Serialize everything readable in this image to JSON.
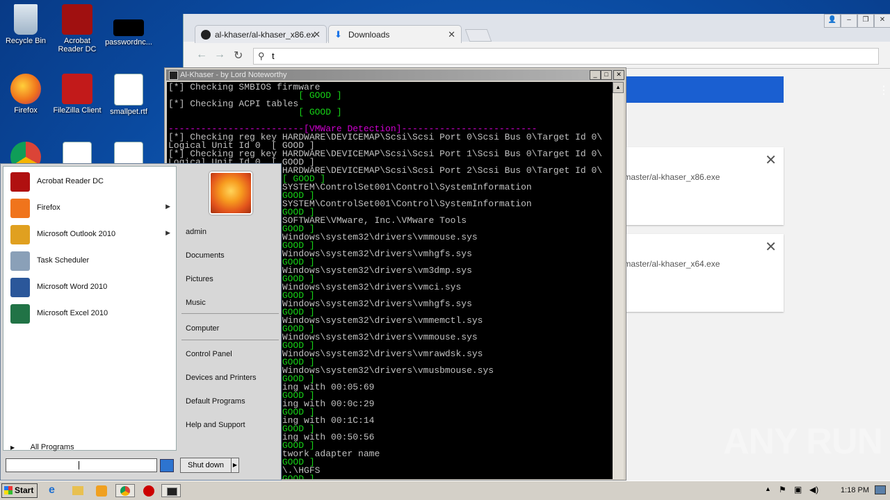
{
  "desktop": {
    "icons": [
      {
        "label": "Recycle Bin"
      },
      {
        "label": "Acrobat Reader DC"
      },
      {
        "label": "passwordnc..."
      },
      {
        "label": "Firefox"
      },
      {
        "label": "FileZilla Client"
      },
      {
        "label": "smallpet.rtf"
      }
    ]
  },
  "chrome": {
    "tabs": [
      {
        "label": "al-khaser/al-khaser_x86.ex"
      },
      {
        "label": "Downloads"
      }
    ],
    "address": "t",
    "downloads": [
      {
        "url": "/master/al-khaser_x86.exe"
      },
      {
        "url": "/master/al-khaser_x64.exe"
      }
    ]
  },
  "console": {
    "title": "Al-Khaser - by Lord Noteworthy",
    "lines": [
      {
        "text": "[*] Checking SMBIOS firmware",
        "style": "w"
      },
      {
        "text": "                        [ GOOD ]",
        "style": "g"
      },
      {
        "text": "[*] Checking ACPI tables",
        "style": "w"
      },
      {
        "text": "                        [ GOOD ]",
        "style": "g"
      },
      {
        "text": "",
        "style": "w"
      },
      {
        "text": "-------------------------[VMWare Detection]-------------------------",
        "style": "m"
      },
      {
        "text": "[*] Checking reg key HARDWARE\\DEVICEMAP\\Scsi\\Scsi Port 0\\Scsi Bus 0\\Target Id 0\\",
        "style": "w"
      },
      {
        "text": "Logical Unit Id 0  [ GOOD ]",
        "style": "w"
      },
      {
        "text": "[*] Checking reg key HARDWARE\\DEVICEMAP\\Scsi\\Scsi Port 1\\Scsi Bus 0\\Target Id 0\\",
        "style": "w"
      },
      {
        "text": "Logical Unit Id 0  [ GOOD ]",
        "style": "w"
      },
      {
        "text": "                     HARDWARE\\DEVICEMAP\\Scsi\\Scsi Port 2\\Scsi Bus 0\\Target Id 0\\",
        "style": "w"
      },
      {
        "text": "                     [ GOOD ]",
        "style": "g"
      },
      {
        "text": "                     SYSTEM\\ControlSet001\\Control\\SystemInformation",
        "style": "w"
      },
      {
        "text": "                     GOOD ]",
        "style": "g"
      },
      {
        "text": "                     SYSTEM\\ControlSet001\\Control\\SystemInformation",
        "style": "w"
      },
      {
        "text": "                     GOOD ]",
        "style": "g"
      },
      {
        "text": "                     SOFTWARE\\VMware, Inc.\\VMware Tools",
        "style": "w"
      },
      {
        "text": "                     GOOD ]",
        "style": "g"
      },
      {
        "text": "                    \\Windows\\system32\\drivers\\vmmouse.sys",
        "style": "w"
      },
      {
        "text": "                     GOOD ]",
        "style": "g"
      },
      {
        "text": "                    \\Windows\\system32\\drivers\\vmhgfs.sys",
        "style": "w"
      },
      {
        "text": "                     GOOD ]",
        "style": "g"
      },
      {
        "text": "                    \\Windows\\system32\\drivers\\vm3dmp.sys",
        "style": "w"
      },
      {
        "text": "                     GOOD ]",
        "style": "g"
      },
      {
        "text": "                    \\Windows\\system32\\drivers\\vmci.sys",
        "style": "w"
      },
      {
        "text": "                     GOOD ]",
        "style": "g"
      },
      {
        "text": "                    \\Windows\\system32\\drivers\\vmhgfs.sys",
        "style": "w"
      },
      {
        "text": "                     GOOD ]",
        "style": "g"
      },
      {
        "text": "                    \\Windows\\system32\\drivers\\vmmemctl.sys",
        "style": "w"
      },
      {
        "text": "                     GOOD ]",
        "style": "g"
      },
      {
        "text": "                    \\Windows\\system32\\drivers\\vmmouse.sys",
        "style": "w"
      },
      {
        "text": "                     GOOD ]",
        "style": "g"
      },
      {
        "text": "                    \\Windows\\system32\\drivers\\vmrawdsk.sys",
        "style": "w"
      },
      {
        "text": "                     GOOD ]",
        "style": "g"
      },
      {
        "text": "                    \\Windows\\system32\\drivers\\vmusbmouse.sys",
        "style": "w"
      },
      {
        "text": "                     GOOD ]",
        "style": "g"
      },
      {
        "text": "                    ting with 00:05:69",
        "style": "w"
      },
      {
        "text": "                     GOOD ]",
        "style": "g"
      },
      {
        "text": "                    ting with 00:0c:29",
        "style": "w"
      },
      {
        "text": "                     GOOD ]",
        "style": "g"
      },
      {
        "text": "                    ting with 00:1C:14",
        "style": "w"
      },
      {
        "text": "                     GOOD ]",
        "style": "g"
      },
      {
        "text": "                    ting with 00:50:56",
        "style": "w"
      },
      {
        "text": "                     GOOD ]",
        "style": "g"
      },
      {
        "text": "                    etwork adapter name",
        "style": "w"
      },
      {
        "text": "                     GOOD ]",
        "style": "g"
      },
      {
        "text": "                    \\\\.\\HGFS",
        "style": "w"
      },
      {
        "text": "                     GOOD ]",
        "style": "g"
      }
    ]
  },
  "startmenu": {
    "programs": [
      {
        "label": "Acrobat Reader DC",
        "has_arrow": false,
        "color": "#b01010"
      },
      {
        "label": "Firefox",
        "has_arrow": true,
        "color": "#f0741c"
      },
      {
        "label": "Microsoft Outlook 2010",
        "has_arrow": true,
        "color": "#e0a020"
      },
      {
        "label": "Task Scheduler",
        "has_arrow": false,
        "color": "#8aa0b8"
      },
      {
        "label": "Microsoft Word 2010",
        "has_arrow": false,
        "color": "#2b579a"
      },
      {
        "label": "Microsoft Excel 2010",
        "has_arrow": false,
        "color": "#217346"
      }
    ],
    "all_programs": "All Programs",
    "user": "admin",
    "links": [
      "Documents",
      "Pictures",
      "Music",
      "Computer",
      "Control Panel",
      "Devices and Printers",
      "Default Programs",
      "Help and Support"
    ],
    "shutdown": "Shut down"
  },
  "taskbar": {
    "start": "Start",
    "clock": "1:18 PM"
  },
  "watermark": "ANY RUN"
}
